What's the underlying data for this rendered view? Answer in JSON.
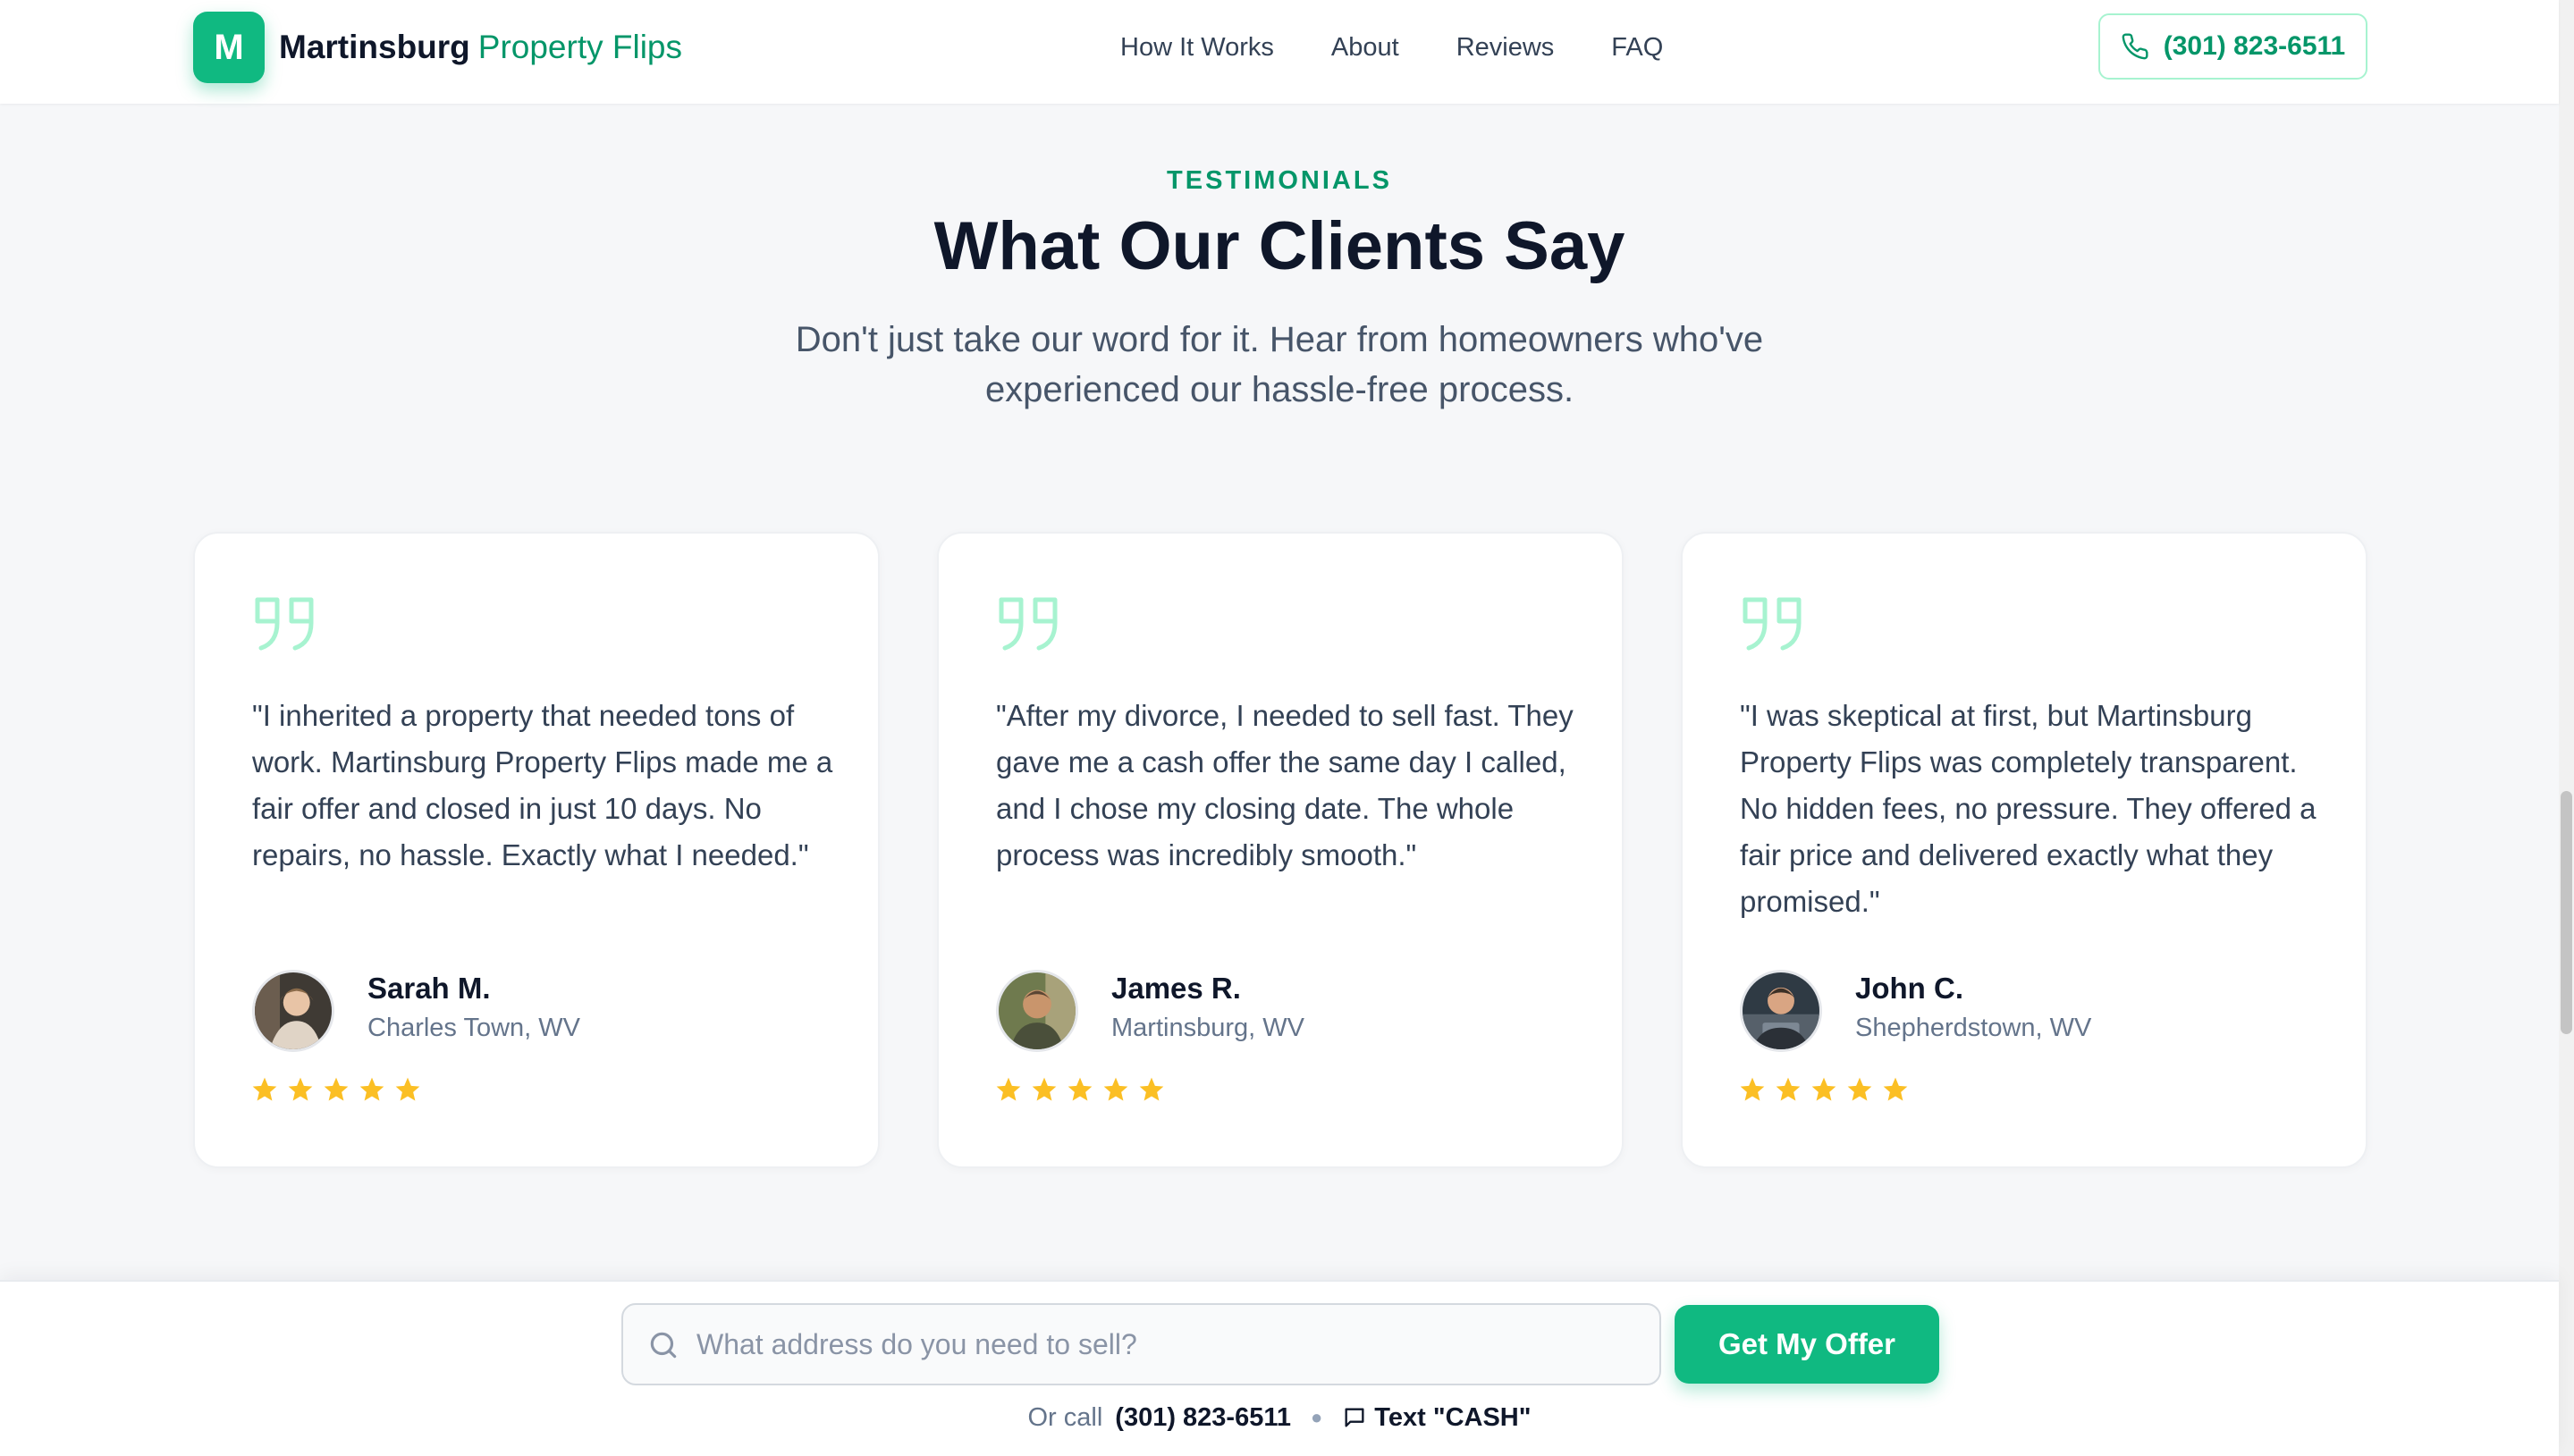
{
  "header": {
    "logo_letter": "M",
    "brand_primary": "Martinsburg",
    "brand_secondary": "Property Flips",
    "nav": [
      "How It Works",
      "About",
      "Reviews",
      "FAQ"
    ],
    "phone": "(301) 823-6511"
  },
  "section": {
    "eyebrow": "TESTIMONIALS",
    "title": "What Our Clients Say",
    "subtitle": "Don't just take our word for it. Hear from homeowners who've experienced our hassle-free process."
  },
  "testimonials": [
    {
      "quote": "\"I inherited a property that needed tons of work. Martinsburg Property Flips made me a fair offer and closed in just 10 days. No repairs, no hassle. Exactly what I needed.\"",
      "name": "Sarah M.",
      "location": "Charles Town, WV",
      "rating": 5
    },
    {
      "quote": "\"After my divorce, I needed to sell fast. They gave me a cash offer the same day I called, and I chose my closing date. The whole process was incredibly smooth.\"",
      "name": "James R.",
      "location": "Martinsburg, WV",
      "rating": 5
    },
    {
      "quote": "\"I was skeptical at first, but Martinsburg Property Flips was completely transparent. No hidden fees, no pressure. They offered a fair price and delivered exactly what they promised.\"",
      "name": "John C.",
      "location": "Shepherdstown, WV",
      "rating": 5
    }
  ],
  "bottom_bar": {
    "search_placeholder": "What address do you need to sell?",
    "search_value": "",
    "cta": "Get My Offer",
    "or_call": "Or call",
    "phone": "(301) 823-6511",
    "text_label": "Text \"CASH\""
  },
  "colors": {
    "accent": "#10b981",
    "accent_dark": "#059669",
    "star": "#fbbf24",
    "quote_icon": "#a7f3d0"
  },
  "icons": {
    "phone": "phone-icon",
    "quote": "quote-icon",
    "star": "star-icon",
    "search": "search-icon",
    "message": "message-icon"
  }
}
